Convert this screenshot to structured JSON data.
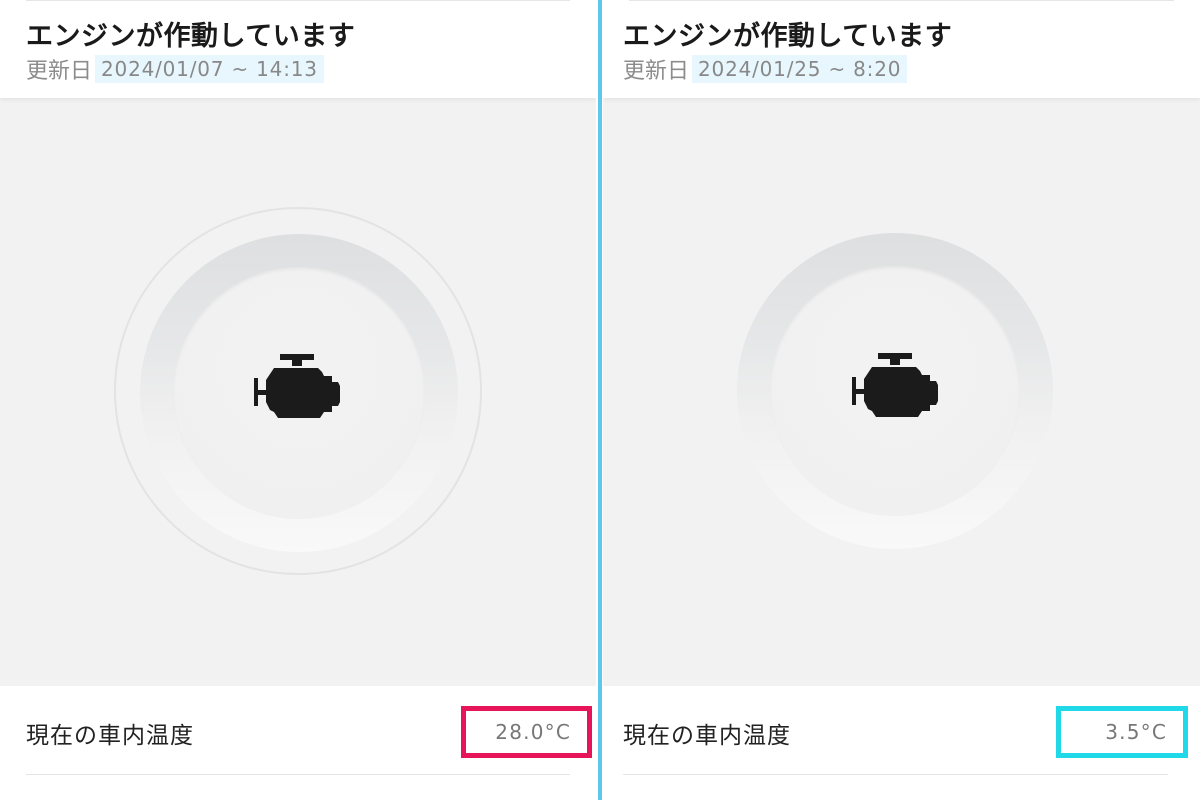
{
  "panels": [
    {
      "status_title": "エンジンが作動しています",
      "updated_label": "更新日",
      "updated_value": "2024/01/07 ~ 14:13",
      "engine_icon": "engine-icon",
      "temperature_label": "現在の車内温度",
      "temperature_value": "28.0°C",
      "highlight_color": "#e8145a"
    },
    {
      "status_title": "エンジンが作動しています",
      "updated_label": "更新日",
      "updated_value": "2024/01/25 ~ 8:20",
      "engine_icon": "engine-icon",
      "temperature_label": "現在の車内温度",
      "temperature_value": "3.5°C",
      "highlight_color": "#1fd8e8"
    }
  ],
  "colors": {
    "divider": "#5ec8ec",
    "date_highlight": "#e8f7fd",
    "dial_background": "#f2f2f2"
  }
}
